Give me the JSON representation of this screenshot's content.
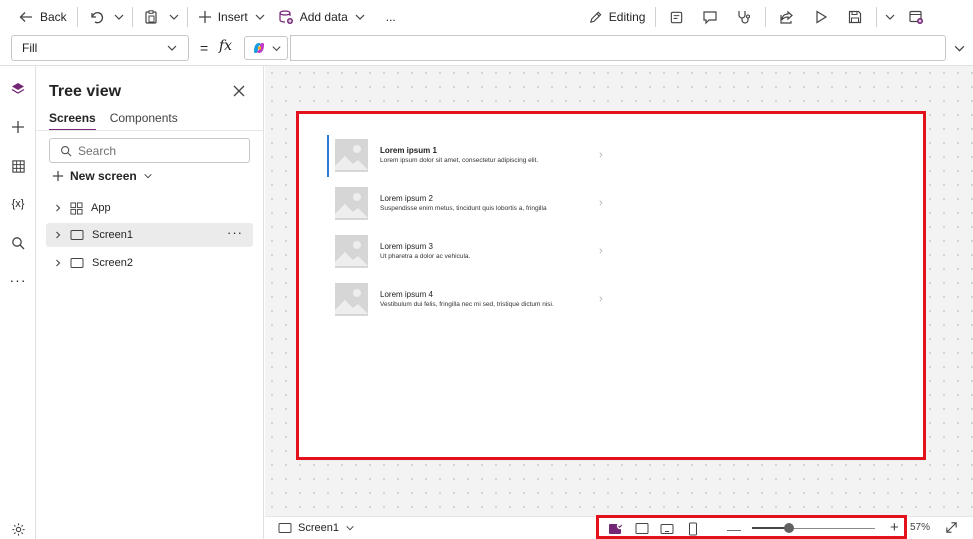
{
  "toolbar": {
    "back_label": "Back",
    "insert_label": "Insert",
    "add_data_label": "Add data",
    "more_label": "...",
    "editing_label": "Editing"
  },
  "formula_bar": {
    "property": "Fill",
    "equals": "=",
    "fx": "fx",
    "formula": ""
  },
  "tree": {
    "title": "Tree view",
    "tabs": [
      "Screens",
      "Components"
    ],
    "active_tab": "Screens",
    "search_placeholder": "Search",
    "new_screen_label": "New screen",
    "nodes": [
      {
        "label": "App",
        "icon": "app-icon",
        "selected": false
      },
      {
        "label": "Screen1",
        "icon": "screen-icon",
        "selected": true
      },
      {
        "label": "Screen2",
        "icon": "screen-icon",
        "selected": false
      }
    ],
    "more_label": "···"
  },
  "gallery": {
    "items": [
      {
        "title": "Lorem ipsum 1",
        "subtitle": "Lorem ipsum dolor sit amet, consectetur adipiscing elit.",
        "selected": true
      },
      {
        "title": "Lorem ipsum 2",
        "subtitle": "Suspendisse enim metus, tincidunt quis lobortis a, fringilla",
        "selected": false
      },
      {
        "title": "Lorem ipsum 3",
        "subtitle": "Ut pharetra a dolor ac vehicula.",
        "selected": false
      },
      {
        "title": "Lorem ipsum 4",
        "subtitle": "Vestibulum dui felis, fringilla nec mi sed, tristique dictum nisi.",
        "selected": false
      }
    ],
    "arrow": "›"
  },
  "status": {
    "screen_name": "Screen1",
    "zoom_label": "57%",
    "zoom_fraction": 0.3,
    "minus": "—",
    "plus": "+"
  },
  "colors": {
    "accent": "#742774",
    "highlight": "#e3111b",
    "selection_bar": "#2b7bd2"
  }
}
